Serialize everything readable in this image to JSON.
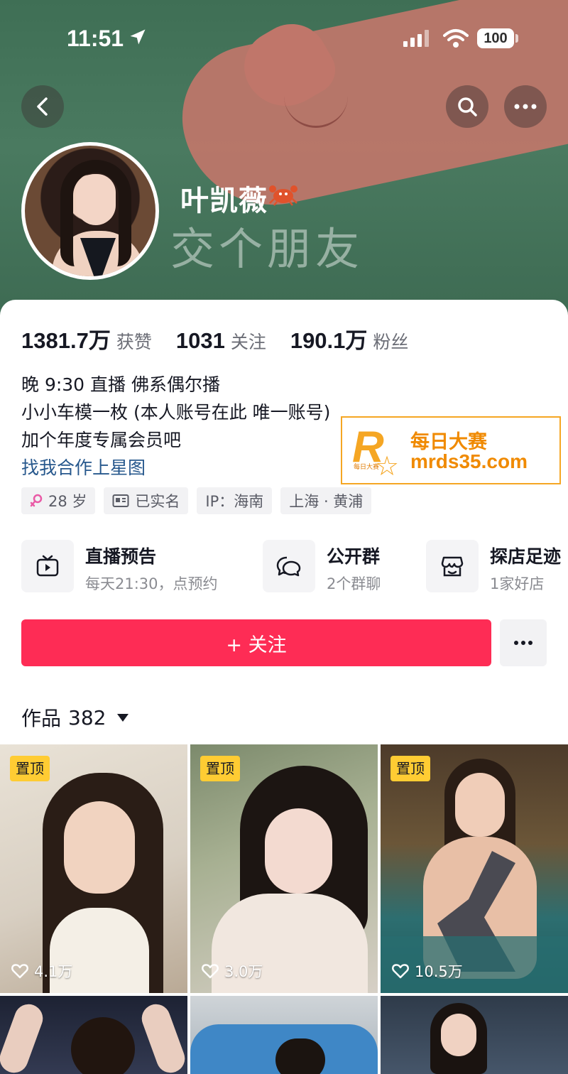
{
  "status_bar": {
    "time": "11:51",
    "battery": "100"
  },
  "profile": {
    "name": "叶凯薇",
    "cover_slogan": "交个朋友",
    "stats": [
      {
        "value": "1381.7万",
        "label": "获赞"
      },
      {
        "value": "1031",
        "label": "关注"
      },
      {
        "value": "190.1万",
        "label": "粉丝"
      }
    ],
    "bio": [
      "晚 9:30 直播 佛系偶尔播",
      "小小车模一枚 (本人账号在此 唯一账号)",
      "加个年度专属会员吧"
    ],
    "bio_link": "找我合作上星图",
    "tags": [
      {
        "icon": "female-icon",
        "text": "28 岁"
      },
      {
        "icon": "id-card-icon",
        "text": "已实名"
      },
      {
        "icon": "",
        "text": "IP：海南"
      },
      {
        "icon": "",
        "text": "上海 · 黄浦"
      }
    ]
  },
  "features": [
    {
      "icon": "tv-icon",
      "title": "直播预告",
      "subtitle": "每天21:30，点预约"
    },
    {
      "icon": "chat-bubbles-icon",
      "title": "公开群",
      "subtitle": "2个群聊"
    },
    {
      "icon": "shop-icon",
      "title": "探店足迹",
      "subtitle": "1家好店"
    }
  ],
  "actions": {
    "follow_label": "+ 关注"
  },
  "works": {
    "label": "作品",
    "count": "382",
    "items": [
      {
        "pinned": "置顶",
        "likes": "4.1万"
      },
      {
        "pinned": "置顶",
        "likes": "3.0万"
      },
      {
        "pinned": "置顶",
        "likes": "10.5万"
      },
      {
        "pinned": "",
        "likes": ""
      },
      {
        "pinned": "",
        "likes": ""
      },
      {
        "pinned": "",
        "likes": ""
      }
    ]
  },
  "watermark": {
    "brand_cn": "每日大赛",
    "brand_small": "每日大赛",
    "url": "mrds35.com",
    "logo_letter": "R"
  },
  "colors": {
    "accent": "#fe2c55",
    "link": "#27588d",
    "pin": "#ffcc33",
    "watermark": "#f08a00"
  }
}
